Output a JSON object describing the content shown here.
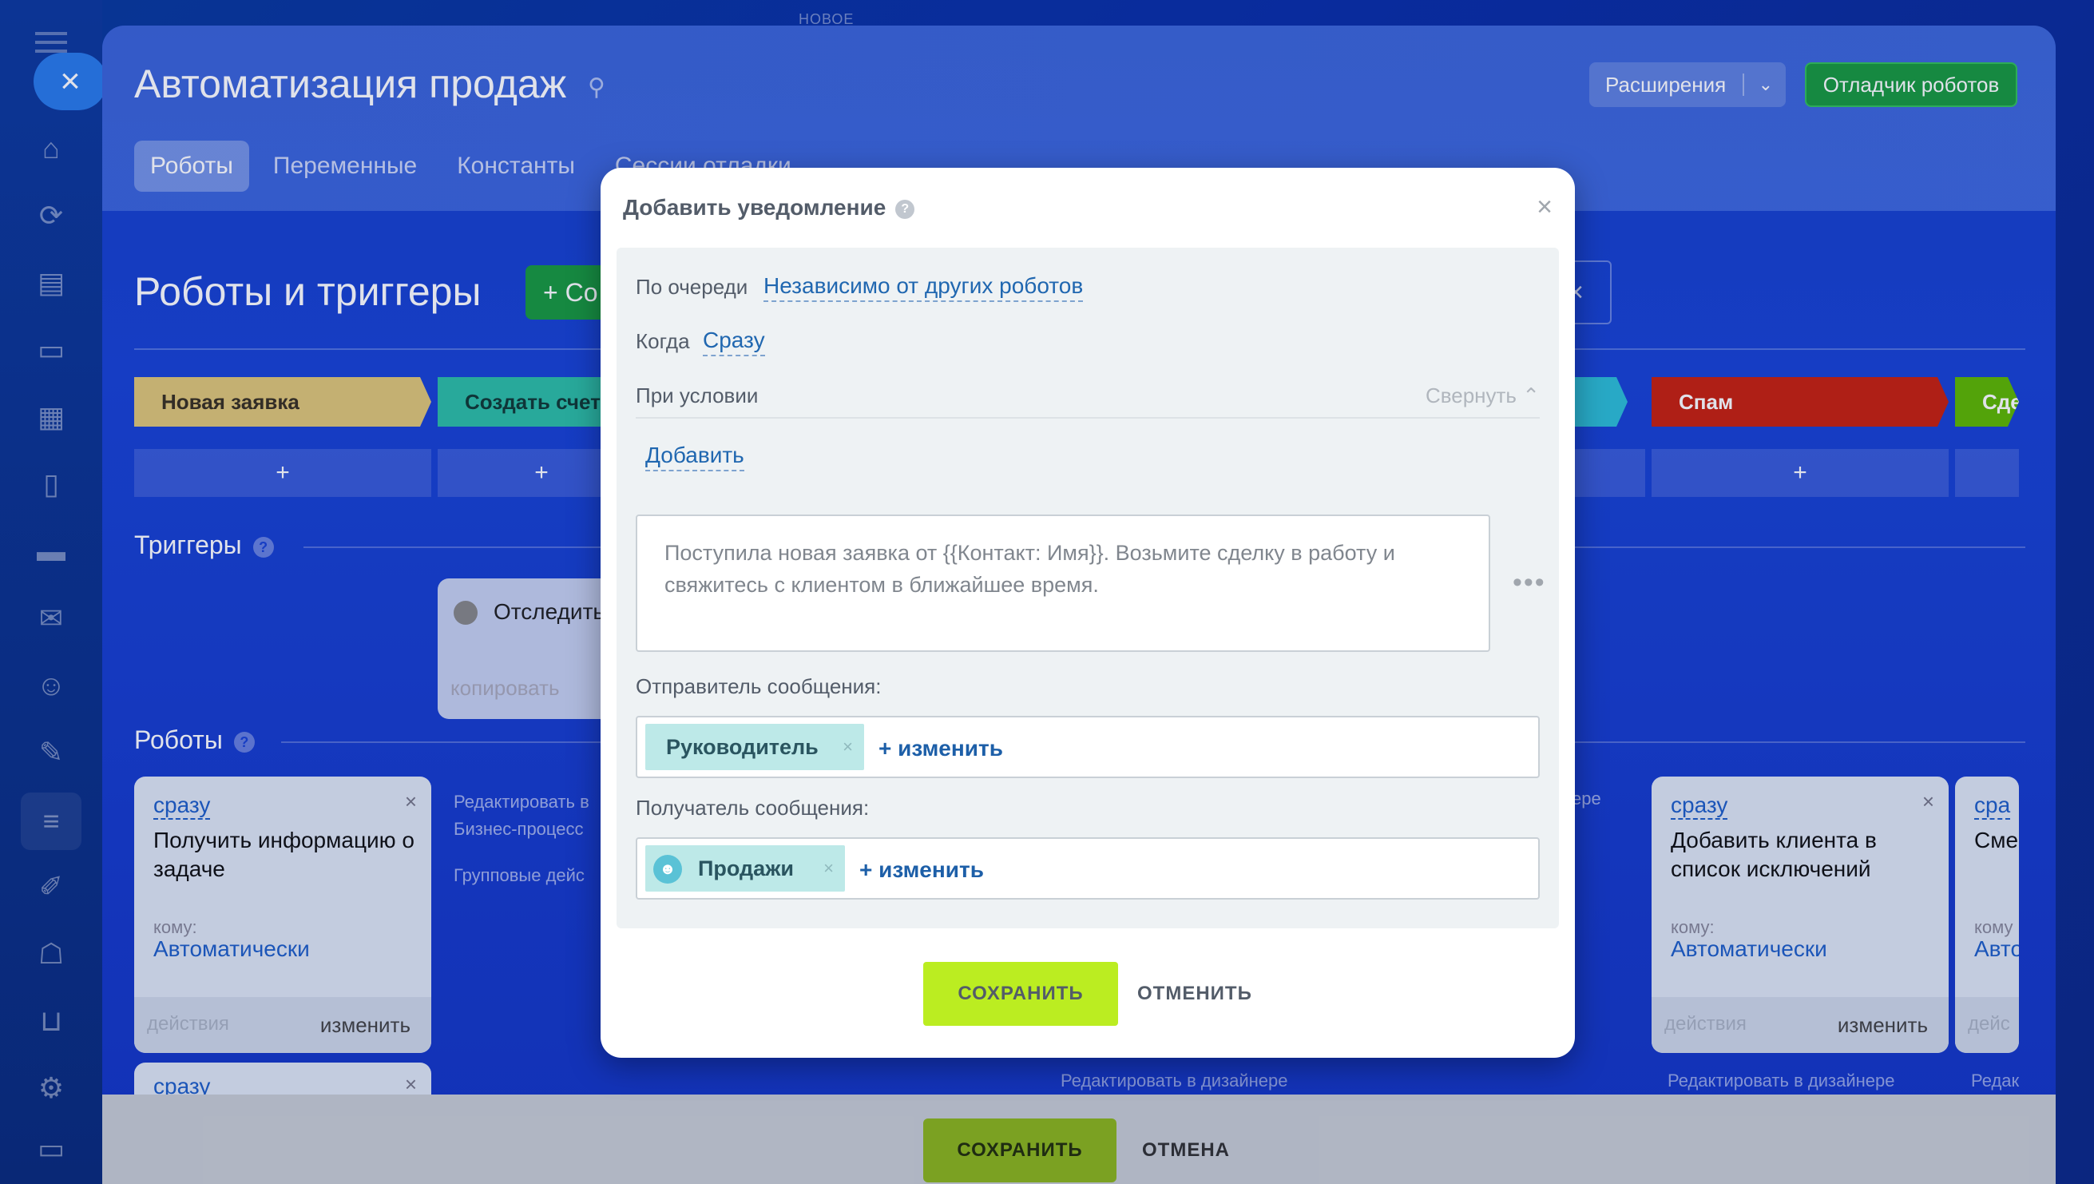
{
  "sidebar": {
    "close_icon": "×",
    "icons": [
      "home-icon",
      "flow-icon",
      "document-icon",
      "chat-icon",
      "calendar-icon",
      "file-icon",
      "drive-icon",
      "mail-icon",
      "contacts-icon",
      "sign-icon",
      "automation-icon",
      "docs-edit-icon",
      "robot-icon",
      "cart-icon",
      "settings-icon",
      "more-icon"
    ]
  },
  "header": {
    "top_tag": "НОВОЕ",
    "title": "Автоматизация продаж",
    "extensions_label": "Расширения",
    "debugger_label": "Отладчик роботов",
    "tabs": [
      {
        "label": "Роботы",
        "active": true
      },
      {
        "label": "Переменные",
        "active": false
      },
      {
        "label": "Константы",
        "active": false
      },
      {
        "label": "Сессии отладки",
        "active": false
      }
    ]
  },
  "main": {
    "section_title": "Роботы и триггеры",
    "create_label": "+ Со",
    "filter_close": "×",
    "stages": [
      {
        "label": "Новая заявка",
        "color": "#e0c677",
        "text_color": "#3a3220"
      },
      {
        "label": "Создать счет",
        "color": "#2ebfa6",
        "text_color": "#123b35"
      },
      {
        "label": "",
        "color": "#2ebfd6",
        "text_color": "#fff"
      },
      {
        "label": "Спам",
        "color": "#c8220e",
        "text_color": "#fff"
      },
      {
        "label": "Сде",
        "color": "#5fb800",
        "text_color": "#fff"
      }
    ],
    "add_symbol": "+",
    "triggers_title": "Триггеры",
    "trigger_card": {
      "name": "Отследить",
      "copy": "копировать"
    },
    "robots_title": "Роботы",
    "robot_cards": [
      {
        "when": "сразу",
        "title": "Получить информацию о задаче",
        "to_label": "кому:",
        "to_value": "Автоматически",
        "actions": "действия",
        "edit": "изменить"
      },
      {
        "when": "сразу",
        "title": "Добавить клиента в список исключений",
        "to_label": "кому:",
        "to_value": "Автоматически",
        "actions": "действия",
        "edit": "изменить"
      },
      {
        "when": "сра",
        "title": "Сме",
        "to_label": "кому",
        "to_value": "Авто",
        "actions": "дейс",
        "edit": ""
      }
    ],
    "side_links": [
      "Редактировать в",
      "Бизнес-процесс",
      "Групповые дейс"
    ],
    "side_link_right": "ере",
    "second_card_when": "сразу",
    "edit_designer": "Редактировать в дизайнере",
    "edit_designer_short": "Редак",
    "help_symbol": "?"
  },
  "bottom_bar": {
    "save_label": "СОХРАНИТЬ",
    "cancel_label": "ОТМЕНА"
  },
  "modal": {
    "title": "Добавить уведомление",
    "queue_label": "По очереди",
    "queue_value": "Независимо от других роботов",
    "when_label": "Когда",
    "when_value": "Сразу",
    "condition_label": "При условии",
    "collapse_label": "Свернуть",
    "add_label": "Добавить",
    "message_text": "Поступила новая заявка от {{Контакт: Имя}}. Возьмите сделку в работу и свяжитесь с клиентом в ближайшее время.",
    "sender_label": "Отправитель сообщения:",
    "sender_chip": "Руководитель",
    "recipient_label": "Получатель сообщения:",
    "recipient_chip": "Продажи",
    "change_label": "+ изменить",
    "save_label": "СОХРАНИТЬ",
    "cancel_label": "ОТМЕНИТЬ"
  }
}
